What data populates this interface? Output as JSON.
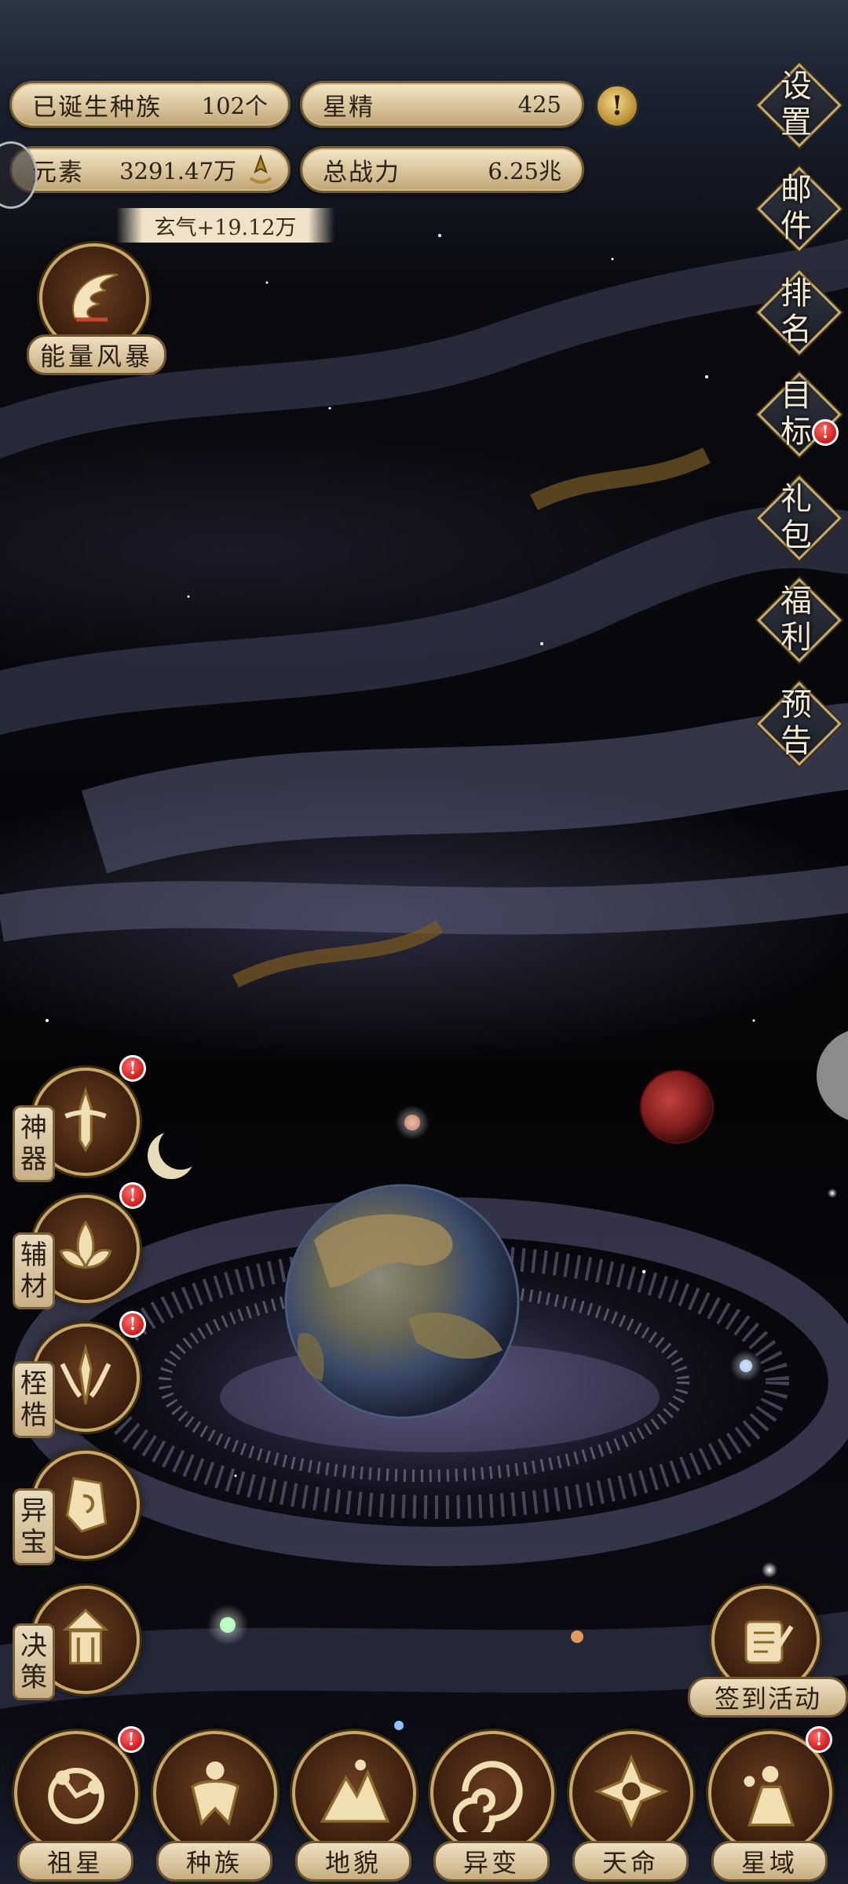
{
  "top_stats": {
    "races_label": "已诞生种族",
    "races_value": "102个",
    "star_essence_label": "星精",
    "star_essence_value": "425",
    "element_label": "元素",
    "element_value": "3291.47万",
    "power_label": "总战力",
    "power_value": "6.25兆",
    "gain_tip": "玄气+19.12万",
    "alert_mark": "!"
  },
  "energy_storm": {
    "label": "能量风暴",
    "icon": "storm-emblem-icon"
  },
  "side_menu": [
    {
      "l1": "设",
      "l2": "置",
      "badge": false
    },
    {
      "l1": "邮",
      "l2": "件",
      "badge": false
    },
    {
      "l1": "排",
      "l2": "名",
      "badge": false
    },
    {
      "l1": "目",
      "l2": "标",
      "badge": true
    },
    {
      "l1": "礼",
      "l2": "包",
      "badge": false
    },
    {
      "l1": "福",
      "l2": "利",
      "badge": false
    },
    {
      "l1": "预",
      "l2": "告",
      "badge": false
    }
  ],
  "left_menu": [
    {
      "l1": "神",
      "l2": "器",
      "icon": "artifact-icon",
      "badge": true
    },
    {
      "l1": "辅",
      "l2": "材",
      "icon": "lotus-icon",
      "badge": true
    },
    {
      "l1": "桎",
      "l2": "梏",
      "icon": "shackle-icon",
      "badge": true
    },
    {
      "l1": "异",
      "l2": "宝",
      "icon": "treasure-icon",
      "badge": false
    },
    {
      "l1": "决",
      "l2": "策",
      "icon": "pavilion-icon",
      "badge": false
    }
  ],
  "signin": {
    "label": "签到活动",
    "icon": "scroll-quill-icon"
  },
  "bottom_nav": [
    {
      "label": "祖星",
      "icon": "home-star-icon",
      "badge": true
    },
    {
      "label": "种族",
      "icon": "race-icon",
      "badge": false
    },
    {
      "label": "地貌",
      "icon": "landform-icon",
      "badge": false
    },
    {
      "label": "异变",
      "icon": "mutation-swirl-icon",
      "badge": false
    },
    {
      "label": "天命",
      "icon": "destiny-icon",
      "badge": false
    },
    {
      "label": "星域",
      "icon": "star-domain-icon",
      "badge": true
    }
  ],
  "badge_mark": "!",
  "colors": {
    "gold": "#caa867",
    "parchment": "#e9dcc0",
    "badge_red": "#d11a1a",
    "space": "#050508"
  }
}
